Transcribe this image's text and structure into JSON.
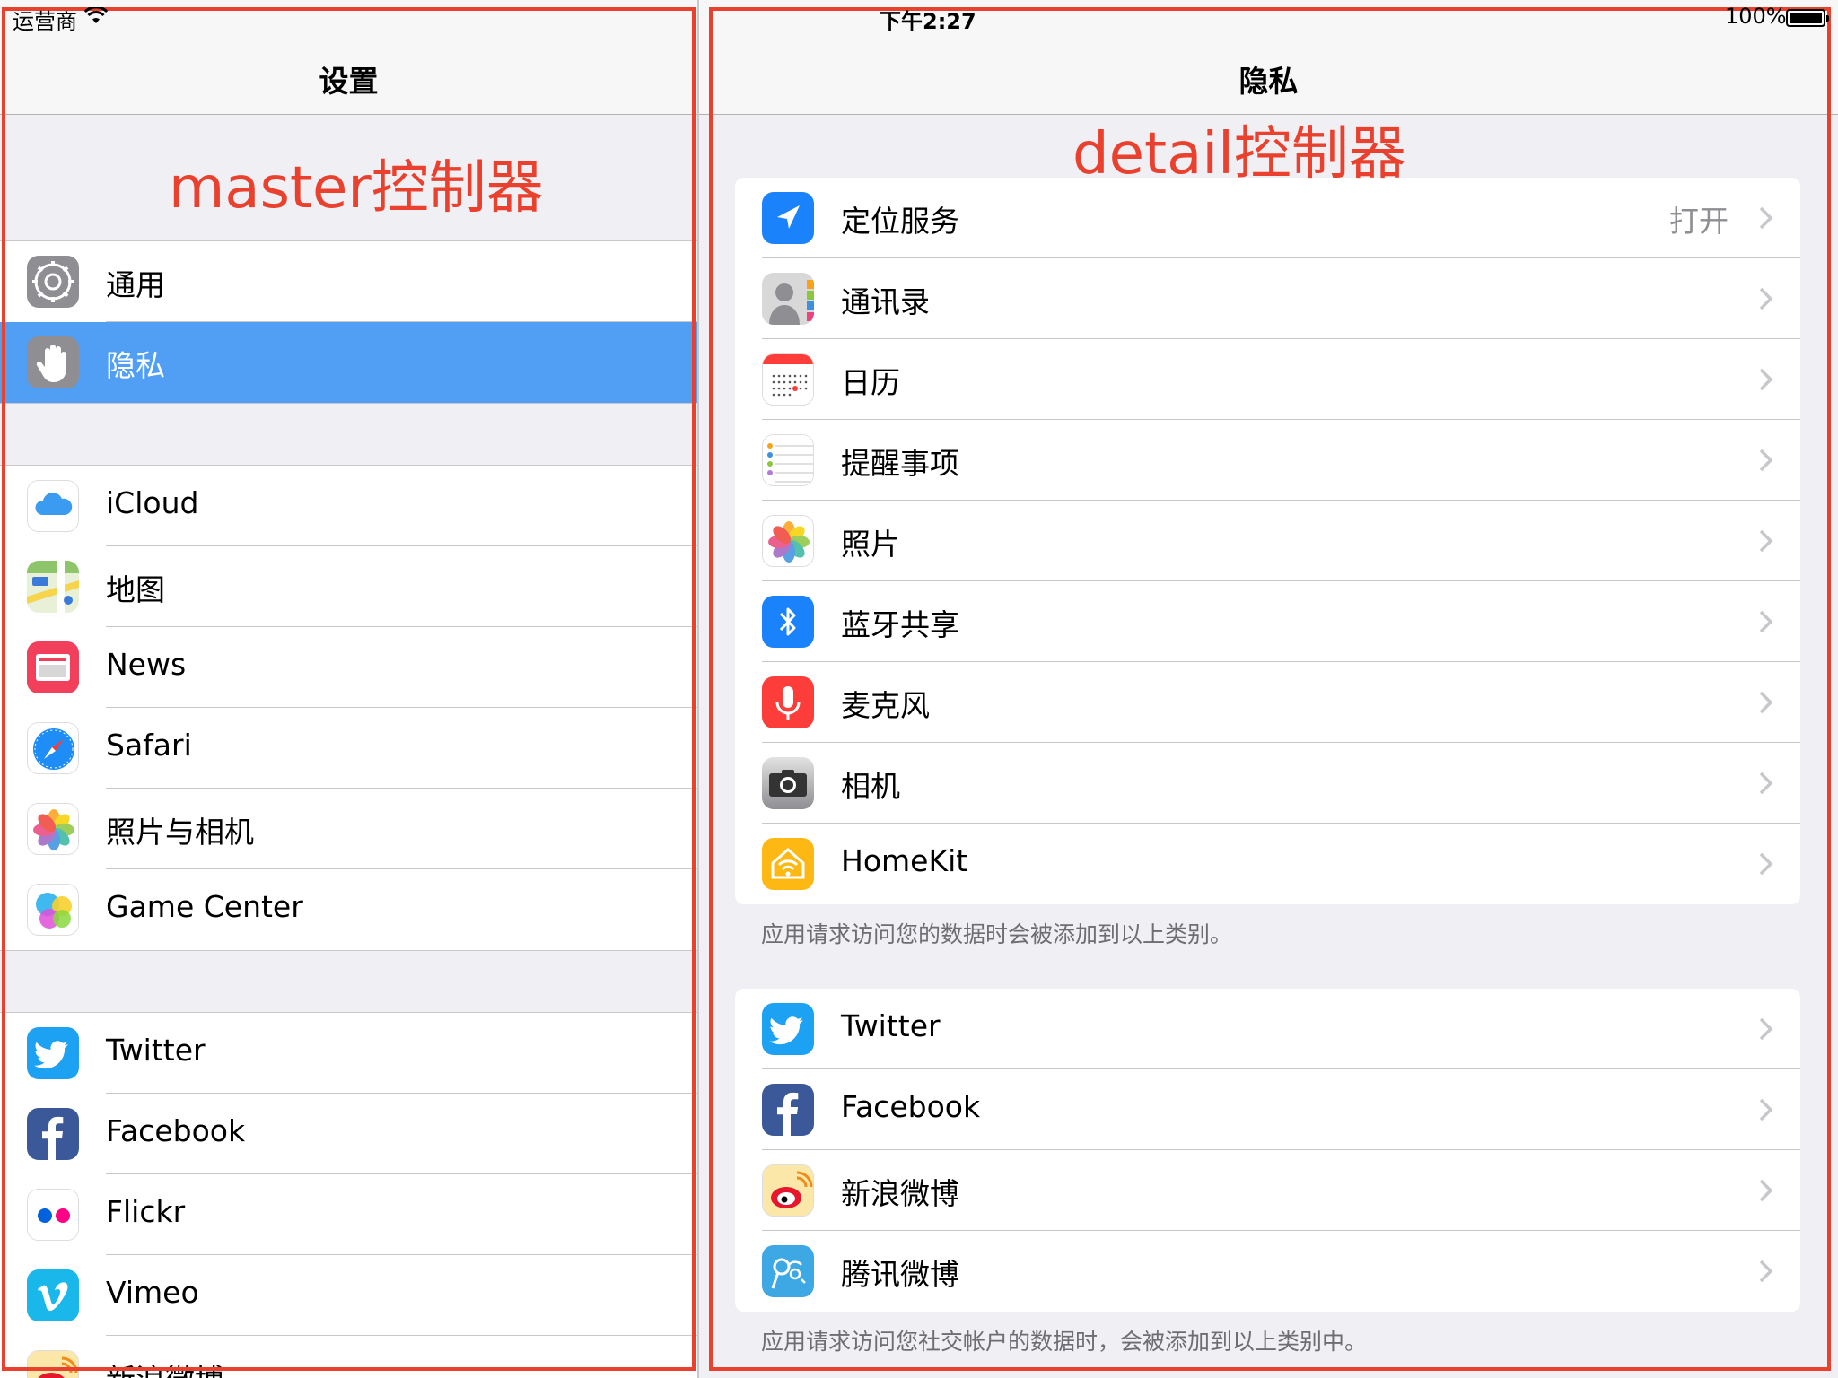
{
  "status_bar": {
    "carrier": "运营商",
    "time": "下午2:27",
    "battery": "100%"
  },
  "master": {
    "title": "设置",
    "annotation": "master控制器",
    "sections": [
      {
        "items": [
          {
            "label": "通用",
            "icon": "gear-icon"
          },
          {
            "label": "隐私",
            "icon": "hand-icon",
            "selected": true
          }
        ]
      },
      {
        "items": [
          {
            "label": "iCloud",
            "icon": "icloud-icon"
          },
          {
            "label": "地图",
            "icon": "maps-icon"
          },
          {
            "label": "News",
            "icon": "news-icon"
          },
          {
            "label": "Safari",
            "icon": "safari-icon"
          },
          {
            "label": "照片与相机",
            "icon": "photos-icon"
          },
          {
            "label": "Game Center",
            "icon": "game-center-icon"
          }
        ]
      },
      {
        "items": [
          {
            "label": "Twitter",
            "icon": "twitter-icon"
          },
          {
            "label": "Facebook",
            "icon": "facebook-icon"
          },
          {
            "label": "Flickr",
            "icon": "flickr-icon"
          },
          {
            "label": "Vimeo",
            "icon": "vimeo-icon"
          },
          {
            "label": "新浪微博",
            "icon": "weibo-icon"
          }
        ]
      }
    ]
  },
  "detail": {
    "title": "隐私",
    "annotation": "detail控制器",
    "group1": [
      {
        "label": "定位服务",
        "value": "打开",
        "icon": "location-arrow-icon"
      },
      {
        "label": "通讯录",
        "icon": "contacts-icon"
      },
      {
        "label": "日历",
        "icon": "calendar-icon"
      },
      {
        "label": "提醒事项",
        "icon": "reminders-icon"
      },
      {
        "label": "照片",
        "icon": "photos-icon"
      },
      {
        "label": "蓝牙共享",
        "icon": "bluetooth-icon"
      },
      {
        "label": "麦克风",
        "icon": "microphone-icon"
      },
      {
        "label": "相机",
        "icon": "camera-icon"
      },
      {
        "label": "HomeKit",
        "icon": "homekit-icon"
      }
    ],
    "footnote1": "应用请求访问您的数据时会被添加到以上类别。",
    "group2": [
      {
        "label": "Twitter",
        "icon": "twitter-icon"
      },
      {
        "label": "Facebook",
        "icon": "facebook-icon"
      },
      {
        "label": "新浪微博",
        "icon": "weibo-icon"
      },
      {
        "label": "腾讯微博",
        "icon": "tencent-weibo-icon"
      }
    ],
    "footnote2": "应用请求访问您社交帐户的数据时，会被添加到以上类别中。"
  },
  "colors": {
    "selection_blue": "#519ff4",
    "annotation_red": "#e9412e",
    "ios_blue": "#1a82fb",
    "twitter_blue": "#1da1f2",
    "facebook_blue": "#3b5998",
    "mic_red": "#fc3d39"
  }
}
